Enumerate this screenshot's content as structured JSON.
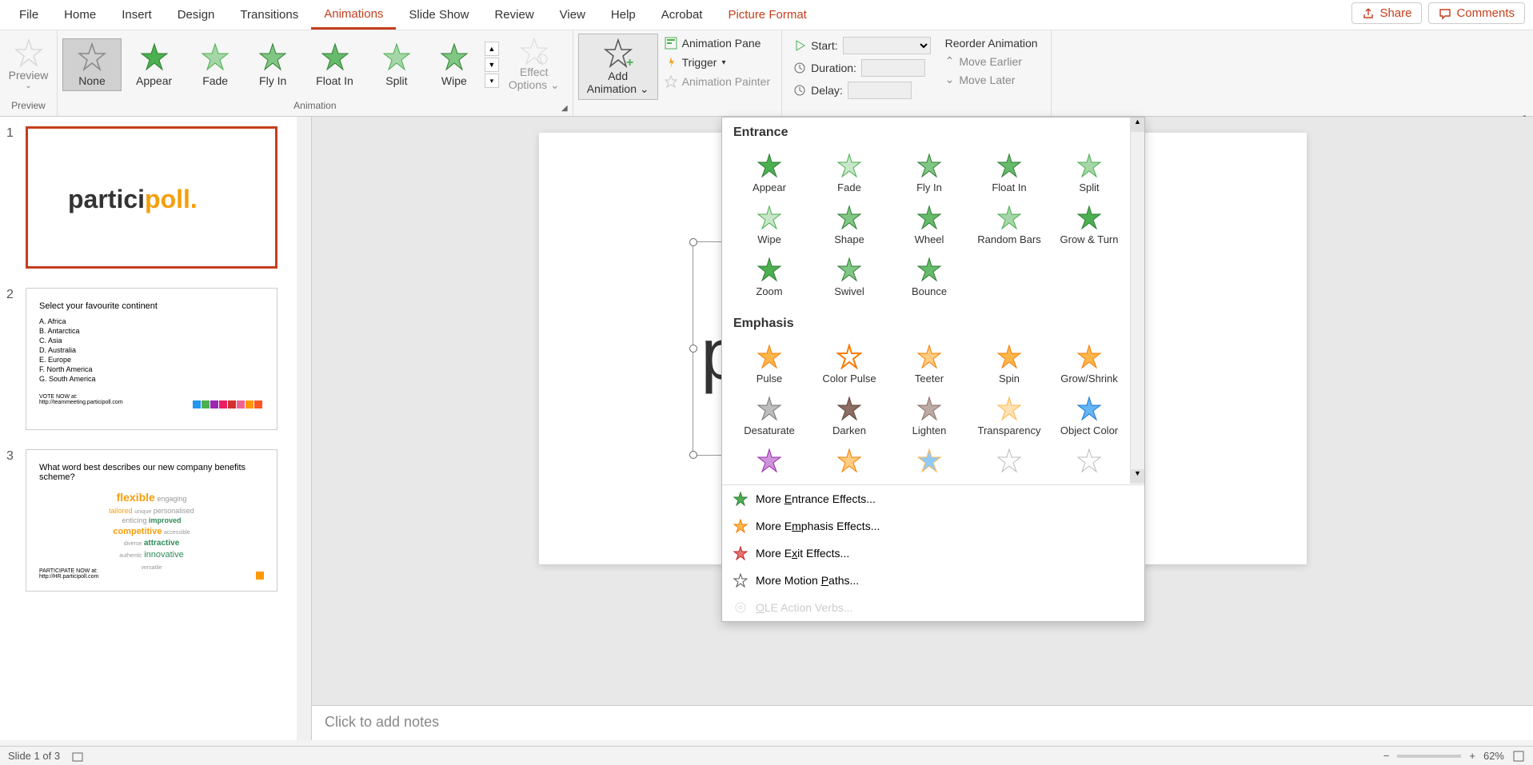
{
  "tabs": {
    "file": "File",
    "home": "Home",
    "insert": "Insert",
    "design": "Design",
    "transitions": "Transitions",
    "animations": "Animations",
    "slideshow": "Slide Show",
    "review": "Review",
    "view": "View",
    "help": "Help",
    "acrobat": "Acrobat",
    "picture_format": "Picture Format"
  },
  "top_buttons": {
    "share": "Share",
    "comments": "Comments"
  },
  "ribbon": {
    "preview": {
      "label": "Preview",
      "group": "Preview"
    },
    "animation_group": "Animation",
    "gallery": {
      "none": "None",
      "appear": "Appear",
      "fade": "Fade",
      "flyin": "Fly In",
      "floatin": "Float In",
      "split": "Split",
      "wipe": "Wipe"
    },
    "effect_options": {
      "l1": "Effect",
      "l2": "Options"
    },
    "add_animation": {
      "l1": "Add",
      "l2": "Animation"
    },
    "advanced": {
      "pane": "Animation Pane",
      "trigger": "Trigger",
      "painter": "Animation Painter"
    },
    "timing": {
      "start": "Start:",
      "duration": "Duration:",
      "delay": "Delay:"
    },
    "reorder": {
      "title": "Reorder Animation",
      "earlier": "Move Earlier",
      "later": "Move Later"
    }
  },
  "dropdown": {
    "entrance_title": "Entrance",
    "entrance": {
      "appear": "Appear",
      "fade": "Fade",
      "flyin": "Fly In",
      "floatin": "Float In",
      "split": "Split",
      "wipe": "Wipe",
      "shape": "Shape",
      "wheel": "Wheel",
      "random": "Random Bars",
      "grow": "Grow & Turn",
      "zoom": "Zoom",
      "swivel": "Swivel",
      "bounce": "Bounce"
    },
    "emphasis_title": "Emphasis",
    "emphasis": {
      "pulse": "Pulse",
      "colorpulse": "Color Pulse",
      "teeter": "Teeter",
      "spin": "Spin",
      "growshrink": "Grow/Shrink",
      "desaturate": "Desaturate",
      "darken": "Darken",
      "lighten": "Lighten",
      "transparency": "Transparency",
      "objcolor": "Object Color"
    },
    "more_entrance": "More Entrance Effects...",
    "more_emphasis": "More Emphasis Effects...",
    "more_exit": "More Exit Effects...",
    "more_motion": "More Motion Paths...",
    "ole": "OLE Action Verbs..."
  },
  "slides": {
    "s1_num": "1",
    "s2_num": "2",
    "s3_num": "3",
    "s1_logo_a": "partici",
    "s1_logo_b": "poll",
    "s1_logo_c": ".",
    "s2_title": "Select your favourite continent",
    "s2_a": "A.  Africa",
    "s2_b": "B.  Antarctica",
    "s2_c": "C.  Asia",
    "s2_d": "D.  Australia",
    "s2_e": "E.  Europe",
    "s2_f": "F.  North America",
    "s2_g": "G.  South America",
    "s2_vote1": "VOTE NOW at:",
    "s2_vote2": "http://teammeeting.participoll.com",
    "s3_title": "What word best describes our new company benefits scheme?",
    "s3_part1": "PARTICIPATE NOW at:",
    "s3_part2": "http://HR.participoll.com",
    "wc": {
      "flexible": "flexible",
      "engaging": "engaging",
      "tailored": "tailored",
      "unique": "unique",
      "personalised": "personalised",
      "enticing": "enticing",
      "improved": "improved",
      "competitive": "competitive",
      "accessible": "accessible",
      "diverse": "diverse",
      "attractive": "attractive",
      "authentic": "authentic",
      "innovative": "innovative",
      "versatile": "versatile"
    }
  },
  "editor": {
    "logo_part": "part"
  },
  "notes": {
    "placeholder": "Click to add notes"
  },
  "status": {
    "slide": "Slide 1 of 3",
    "zoom": "62%"
  }
}
